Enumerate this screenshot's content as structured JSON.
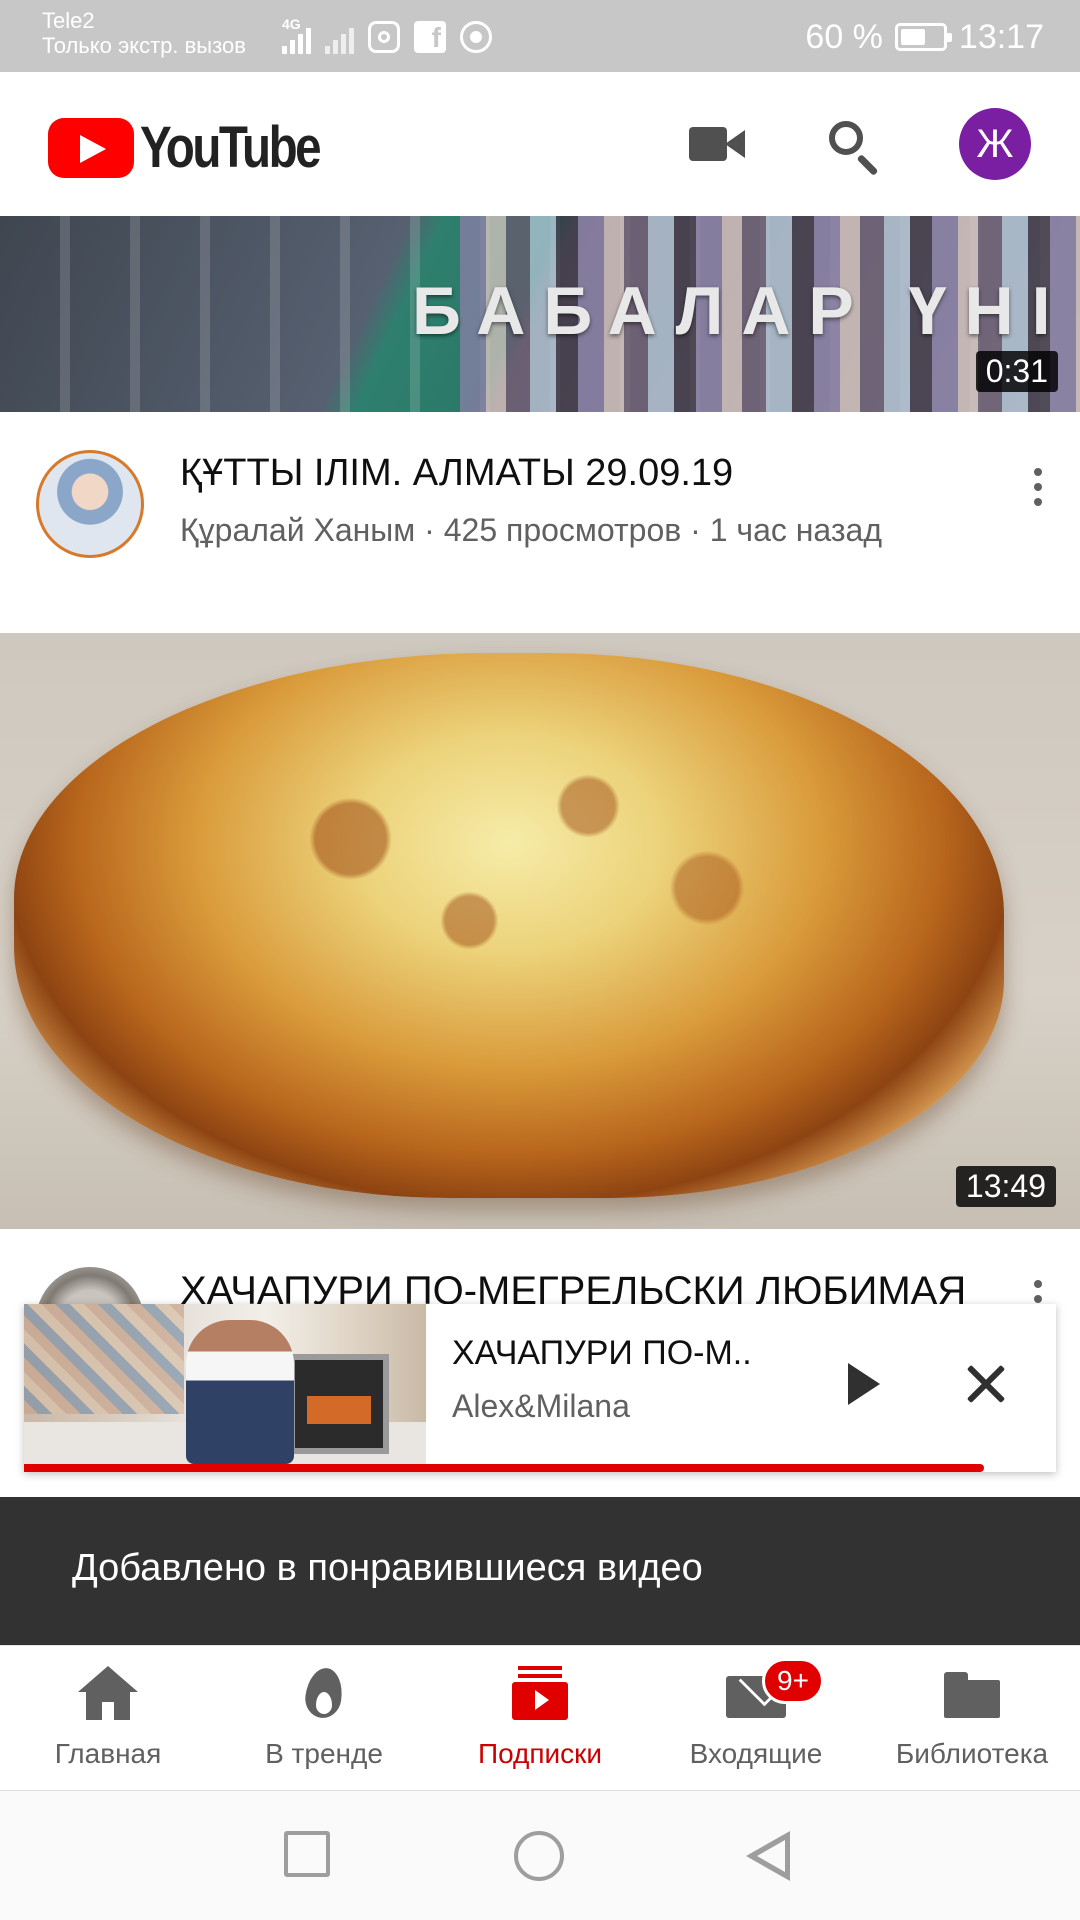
{
  "status_bar": {
    "carrier": "Tele2",
    "emergency": "Только экстр. вызов",
    "network": "4G",
    "battery": "60 %",
    "battery_level": 0.6,
    "time": "13:17",
    "app_icons": [
      "instagram-icon",
      "facebook-icon",
      "chrome-icon"
    ]
  },
  "header": {
    "logo_text": "YouTube",
    "account_initial": "Ж",
    "icons": [
      "video-camera-icon",
      "search-icon"
    ]
  },
  "videos": [
    {
      "thumbnail_overlay": "БАБАЛАР ҮНІ",
      "duration": "0:31",
      "title": "ҚҰТТЫ ІЛІМ. АЛМАТЫ 29.09.19",
      "subtitle": "Құралай Ханым · 425 просмотров · 1 час назад"
    },
    {
      "duration": "13:49",
      "title": "ХАЧАПУРИ ПО-МЕГРЕЛЬСКИ ЛЮБИМАЯ"
    }
  ],
  "miniplayer": {
    "title": "ХАЧАПУРИ ПО-М..",
    "channel": "Alex&Milana",
    "progress": 0.93
  },
  "snackbar": {
    "text": "Добавлено в понравившиеся видео"
  },
  "bottom_nav": {
    "items": [
      {
        "label": "Главная",
        "icon": "home-icon"
      },
      {
        "label": "В тренде",
        "icon": "trending-icon"
      },
      {
        "label": "Подписки",
        "icon": "subscriptions-icon",
        "active": true
      },
      {
        "label": "Входящие",
        "icon": "inbox-icon",
        "badge": "9+"
      },
      {
        "label": "Библиотека",
        "icon": "library-icon"
      }
    ]
  },
  "colors": {
    "accent": "#e00000",
    "avatar_bg": "#7b1fa2",
    "status_bar_bg": "#c7c7c7",
    "snackbar_bg": "#323232"
  }
}
